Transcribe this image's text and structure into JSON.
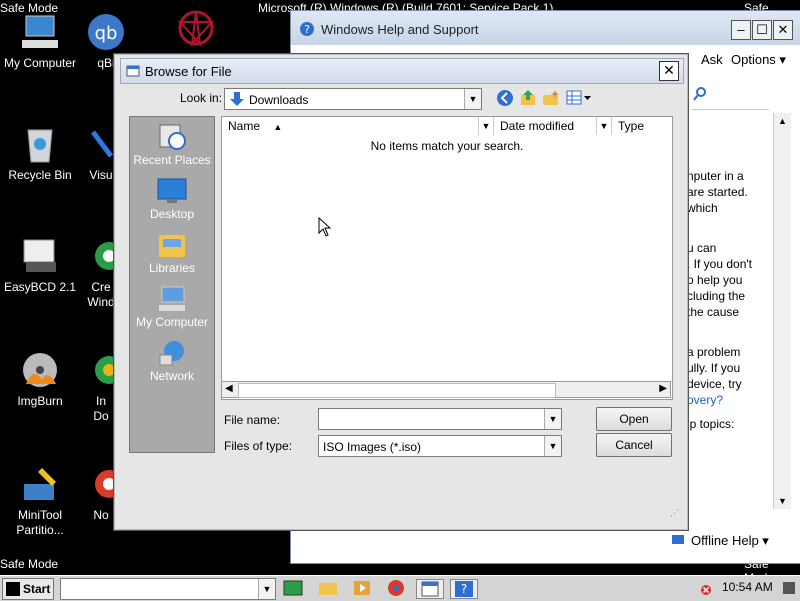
{
  "desktop": {
    "safe_mode": "Safe Mode",
    "title_top": "Microsoft (R) Windows (R) (Build 7601: Service Pack 1)",
    "icons": [
      {
        "label": "My Computer"
      },
      {
        "label": "qBi"
      },
      {
        "label": "Recycle Bin"
      },
      {
        "label": "Visu"
      },
      {
        "label": "EasyBCD 2.1"
      },
      {
        "label": "Cre"
      },
      {
        "label": "Wind"
      },
      {
        "label": "ImgBurn"
      },
      {
        "label": "In"
      },
      {
        "label": "Do"
      },
      {
        "label": "MiniTool"
      },
      {
        "label": "Partitio..."
      },
      {
        "label": "No"
      }
    ]
  },
  "help_window": {
    "title": "Windows Help and Support",
    "menu_ask": "Ask",
    "menu_options": "Options",
    "lines": [
      "nputer in a",
      "are started.",
      "which",
      "u can",
      ". If you don't",
      "o help you",
      "cluding the",
      "the cause",
      "a problem",
      "ully. If you",
      "device, try",
      "overy?",
      "lp topics:"
    ],
    "offline_help": "Offline Help"
  },
  "dialog": {
    "title": "Browse for File",
    "look_in_label": "Look in:",
    "look_in_value": "Downloads",
    "places": [
      {
        "label": "Recent Places"
      },
      {
        "label": "Desktop"
      },
      {
        "label": "Libraries"
      },
      {
        "label": "My Computer"
      },
      {
        "label": "Network"
      }
    ],
    "columns": {
      "name": "Name",
      "date": "Date modified",
      "type": "Type"
    },
    "empty_message": "No items match your search.",
    "file_name_label": "File name:",
    "file_name_value": "",
    "files_of_type_label": "Files of type:",
    "files_of_type_value": "ISO Images (*.iso)",
    "open_label": "Open",
    "cancel_label": "Cancel"
  },
  "taskbar": {
    "start_label": "Start",
    "clock": "10:54 AM"
  }
}
